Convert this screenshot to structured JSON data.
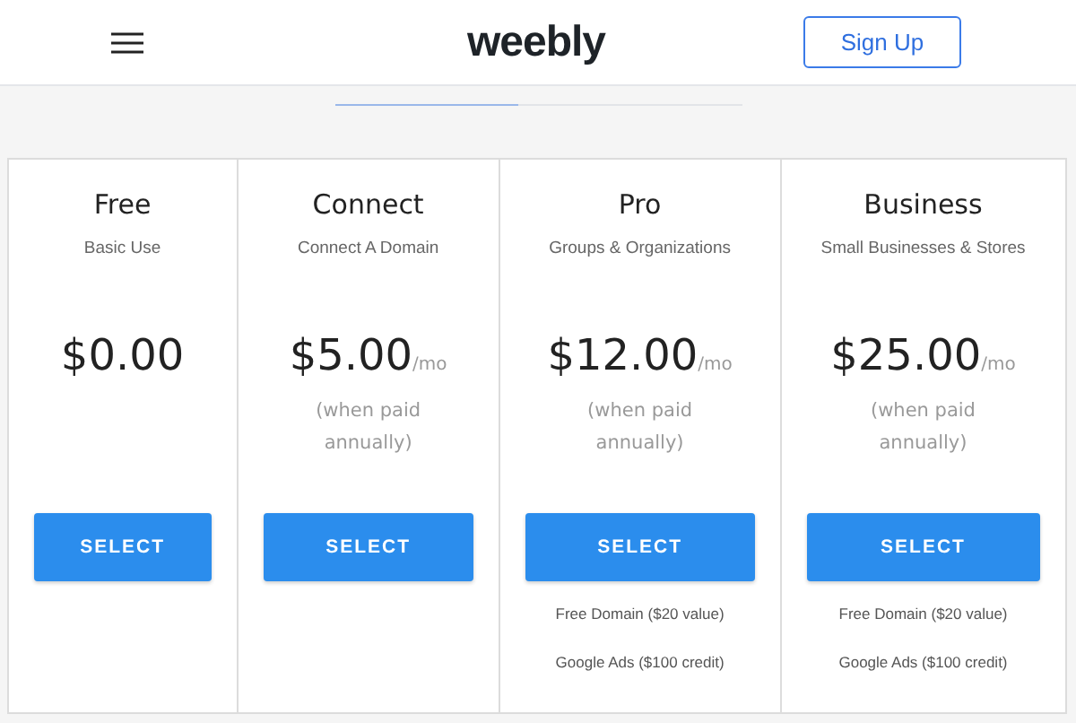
{
  "header": {
    "logo": "weebly",
    "signup": "Sign Up"
  },
  "tabs": [
    {
      "selected": true
    },
    {
      "selected": false
    }
  ],
  "plans": [
    {
      "name": "Free",
      "subtitle": "Basic Use",
      "price": "$0.00",
      "button": "SELECT"
    },
    {
      "name": "Connect",
      "subtitle": "Connect A Domain",
      "price": "$5.00",
      "unit": "/mo",
      "note": "(when paid annually)",
      "button": "SELECT"
    },
    {
      "name": "Pro",
      "subtitle": "Groups & Organizations",
      "price": "$12.00",
      "unit": "/mo",
      "note": "(when paid annually)",
      "button": "SELECT",
      "features": [
        "Free Domain ($20 value)",
        "Google Ads ($100 credit)"
      ]
    },
    {
      "name": "Business",
      "subtitle": "Small Businesses & Stores",
      "price": "$25.00",
      "unit": "/mo",
      "note": "(when paid annually)",
      "button": "SELECT",
      "features": [
        "Free Domain ($20 value)",
        "Google Ads ($100 credit)"
      ]
    }
  ]
}
